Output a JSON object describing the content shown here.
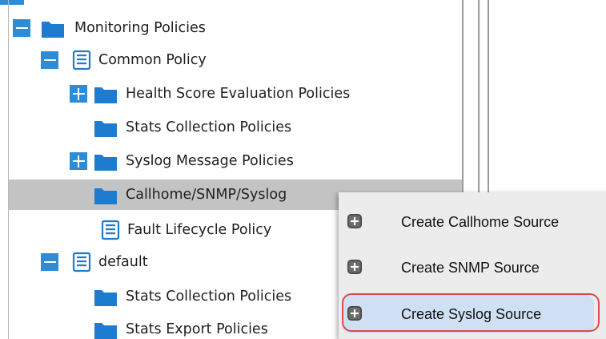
{
  "tree": {
    "items": [
      {
        "label": "Monitoring Policies",
        "toggle": "minus",
        "icon": "folder-icon"
      },
      {
        "label": "Common Policy",
        "toggle": "minus",
        "icon": "policy-icon"
      },
      {
        "label": "Health Score Evaluation Policies",
        "toggle": "plus",
        "icon": "folder-icon"
      },
      {
        "label": "Stats Collection Policies",
        "toggle": "none",
        "icon": "folder-icon"
      },
      {
        "label": "Syslog Message Policies",
        "toggle": "plus",
        "icon": "folder-icon"
      },
      {
        "label": "Callhome/SNMP/Syslog",
        "toggle": "none",
        "icon": "folder-icon",
        "selected": true
      },
      {
        "label": "Fault Lifecycle Policy",
        "toggle": "none",
        "icon": "policy-icon"
      },
      {
        "label": "default",
        "toggle": "minus",
        "icon": "policy-icon"
      },
      {
        "label": "Stats Collection Policies",
        "toggle": "none",
        "icon": "folder-icon"
      },
      {
        "label": "Stats Export Policies",
        "toggle": "none",
        "icon": "folder-icon"
      }
    ]
  },
  "context_menu": {
    "items": [
      {
        "label": "Create Callhome Source",
        "icon": "add-icon"
      },
      {
        "label": "Create SNMP Source",
        "icon": "add-icon"
      },
      {
        "label": "Create Syslog Source",
        "icon": "add-icon",
        "highlighted": true
      }
    ]
  },
  "colors": {
    "toggle": "#2d8cd5",
    "folder": "#1d7ccf",
    "selected_row": "#c3c3c3",
    "menu_background": "#ececec",
    "menu_hover": "#cfe0f4",
    "highlight_ring": "#d94a4a"
  }
}
